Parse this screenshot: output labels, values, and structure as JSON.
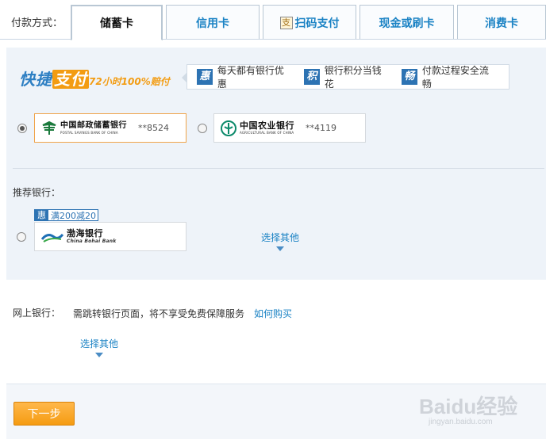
{
  "payment": {
    "label": "付款方式：",
    "tabs": [
      {
        "label": "储蓄卡",
        "active": true
      },
      {
        "label": "信用卡"
      },
      {
        "label": "扫码支付",
        "icon": "alipay-scan-icon",
        "icon_glyph": "支"
      },
      {
        "label": "现金或刷卡"
      },
      {
        "label": "消费卡"
      }
    ]
  },
  "quickpay": {
    "logo_main": "快捷",
    "logo_highlight": "支付",
    "logo_sub": "72小时100%赔付",
    "perks": [
      {
        "icon": "hui-icon",
        "glyph": "惠",
        "text": "每天都有银行优惠"
      },
      {
        "icon": "ji-icon",
        "glyph": "积",
        "text": "银行积分当钱花"
      },
      {
        "icon": "chang-icon",
        "glyph": "畅",
        "text": "付款过程安全流畅"
      }
    ]
  },
  "saved_cards": [
    {
      "bank_cn": "中国邮政储蓄银行",
      "bank_en": "POSTAL SAVINGS BANK OF CHINA",
      "account": "**8524",
      "selected": true,
      "color": "#1a7a3c"
    },
    {
      "bank_cn": "中国农业银行",
      "bank_en": "AGRICULTURAL BANK OF CHINA",
      "account": "**4119",
      "selected": false,
      "color": "#0c8a6b"
    }
  ],
  "recommended": {
    "label": "推荐银行：",
    "promo_glyph": "惠",
    "promo_text": "满200减20",
    "bank_cn": "渤海银行",
    "bank_en": "China Bohai Bank",
    "more": "选择其他"
  },
  "online_bank": {
    "label": "网上银行：",
    "desc": "需跳转银行页面，将不享受免费保障服务",
    "how_link": "如何购买",
    "more": "选择其他"
  },
  "footer": {
    "next": "下一步",
    "watermark": "Baidu经验",
    "watermark_sub": "jingyan.baidu.com"
  },
  "colors": {
    "accent": "#1a82c4",
    "orange": "#f59c12",
    "panel_bg": "#eef3f9"
  }
}
